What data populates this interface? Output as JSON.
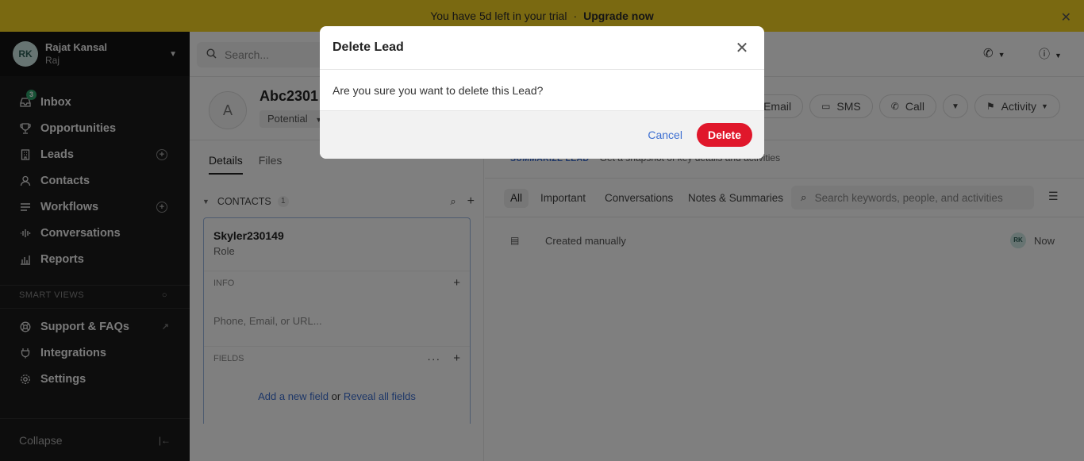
{
  "banner": {
    "text": "You have 5d left in your trial",
    "separator": "·",
    "upgrade": "Upgrade now",
    "close": "✕"
  },
  "user": {
    "initials": "RK",
    "name": "Rajat Kansal",
    "org": "Raj"
  },
  "nav": {
    "inbox": {
      "label": "Inbox",
      "badge": "3"
    },
    "opportunities": "Opportunities",
    "leads": "Leads",
    "contacts": "Contacts",
    "workflows": "Workflows",
    "conversations": "Conversations",
    "reports": "Reports"
  },
  "smart_views": "SMART VIEWS",
  "nav2": {
    "support": "Support & FAQs",
    "integrations": "Integrations",
    "settings": "Settings"
  },
  "collapse": "Collapse",
  "search": {
    "placeholder": "Search..."
  },
  "lead": {
    "avatar": "A",
    "name": "Abc2301",
    "status": "Potential",
    "actions": {
      "email": "Email",
      "sms": "SMS",
      "call": "Call",
      "activity": "Activity"
    }
  },
  "left_tabs": {
    "details": "Details",
    "files": "Files"
  },
  "contacts_section": {
    "title": "CONTACTS",
    "count": "1"
  },
  "contact": {
    "name": "Skyler230149",
    "role": "Role",
    "info_label": "INFO",
    "info_placeholder": "Phone, Email, or URL...",
    "fields_label": "FIELDS",
    "add_field": "Add a new field",
    "or": "or",
    "reveal": "Reveal all fields"
  },
  "summarize": {
    "label": "SUMMARIZE LEAD",
    "text": "Get a snapshot of key details and activities"
  },
  "feed_tabs": {
    "all": "All",
    "important": "Important",
    "conversations": "Conversations",
    "notes": "Notes & Summaries"
  },
  "feed_search": {
    "placeholder": "Search keywords, people, and activities"
  },
  "feed": {
    "text": "Created manually",
    "author": "RK",
    "time": "Now"
  },
  "modal": {
    "title": "Delete Lead",
    "message": "Are you sure you want to delete this Lead?",
    "cancel": "Cancel",
    "confirm": "Delete"
  },
  "colors": {
    "banner": "#f5d223",
    "sidebar": "#1b1b1b",
    "danger": "#e0172b",
    "link": "#3d6fd1"
  }
}
